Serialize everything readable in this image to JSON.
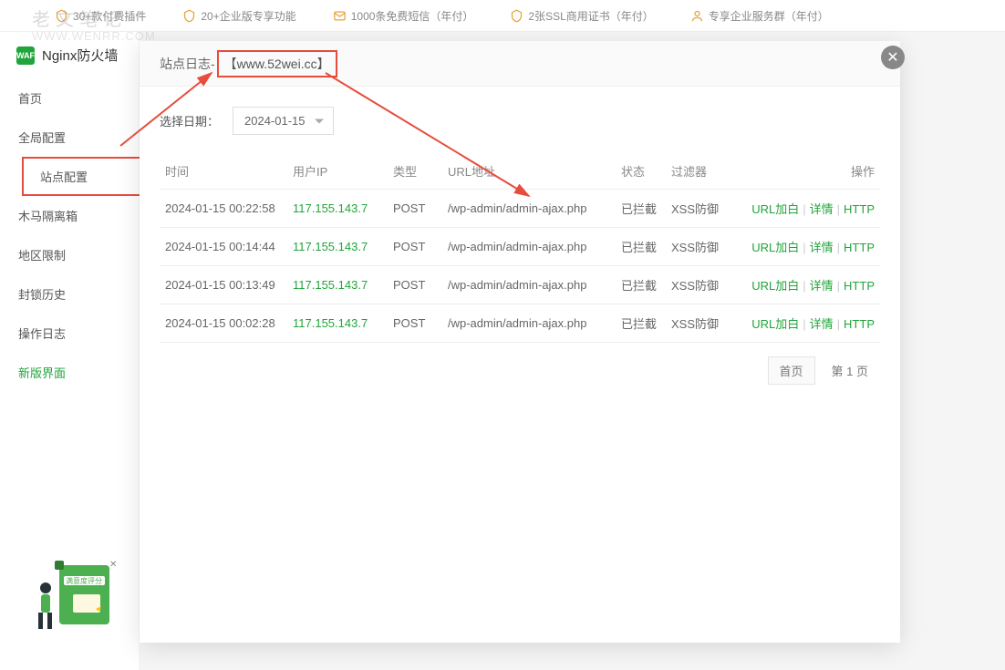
{
  "watermark_main": "老文笔记",
  "watermark_sub": "WWW.WENRR.COM",
  "top_banner": [
    "30+款付费插件",
    "20+企业版专享功能",
    "1000条免费短信（年付）",
    "2张SSL商用证书（年付）",
    "专享企业服务群（年付）"
  ],
  "sidebar": {
    "title": "Nginx防火墙",
    "shield_text": "WAF",
    "items": [
      "首页",
      "全局配置",
      "站点配置",
      "木马隔离箱",
      "地区限制",
      "封锁历史",
      "操作日志",
      "新版界面"
    ]
  },
  "modal": {
    "title_prefix": "站点日志-",
    "site_name": "【www.52wei.cc】",
    "date_label": "选择日期：",
    "date_value": "2024-01-15",
    "headers": {
      "time": "时间",
      "ip": "用户IP",
      "type": "类型",
      "url": "URL地址",
      "status": "状态",
      "filter": "过滤器",
      "action": "操作"
    },
    "rows": [
      {
        "time": "2024-01-15 00:22:58",
        "ip": "117.155.143.7",
        "type": "POST",
        "url": "/wp-admin/admin-ajax.php",
        "status": "已拦截",
        "filter": "XSS防御"
      },
      {
        "time": "2024-01-15 00:14:44",
        "ip": "117.155.143.7",
        "type": "POST",
        "url": "/wp-admin/admin-ajax.php",
        "status": "已拦截",
        "filter": "XSS防御"
      },
      {
        "time": "2024-01-15 00:13:49",
        "ip": "117.155.143.7",
        "type": "POST",
        "url": "/wp-admin/admin-ajax.php",
        "status": "已拦截",
        "filter": "XSS防御"
      },
      {
        "time": "2024-01-15 00:02:28",
        "ip": "117.155.143.7",
        "type": "POST",
        "url": "/wp-admin/admin-ajax.php",
        "status": "已拦截",
        "filter": "XSS防御"
      }
    ],
    "actions": {
      "whitelist": "URL加白",
      "detail": "详情",
      "http": "HTTP"
    },
    "pagination": {
      "first": "首页",
      "current": "第 1 页"
    }
  },
  "feedback_label": "满意度评分"
}
